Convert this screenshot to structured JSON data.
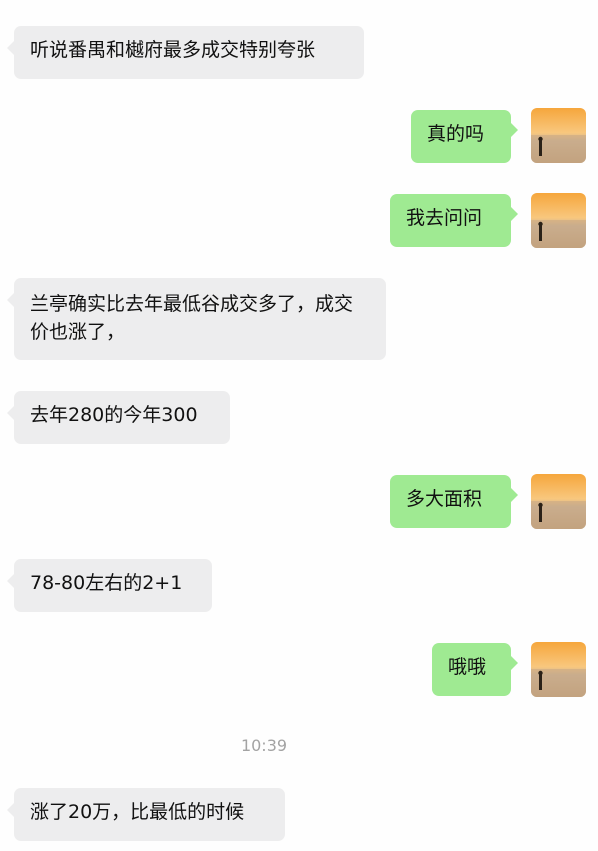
{
  "messages": [
    {
      "side": "left",
      "text": "听说番禺和樾府最多成交特别夸张"
    },
    {
      "side": "right",
      "text": "真的吗"
    },
    {
      "side": "right",
      "text": "我去问问"
    },
    {
      "side": "left",
      "text": "兰亭确实比去年最低谷成交多了，成交价也涨了，"
    },
    {
      "side": "left",
      "text": "去年280的今年300"
    },
    {
      "side": "right",
      "text": "多大面积"
    },
    {
      "side": "left",
      "text": "78-80左右的2+1"
    },
    {
      "side": "right",
      "text": "哦哦"
    },
    {
      "side": "left",
      "text": "涨了20万，比最低的时候"
    }
  ],
  "timestamp": "10:39",
  "colors": {
    "incoming_bubble": "#ededee",
    "outgoing_bubble": "#9fea92",
    "background": "#fefefe",
    "timestamp": "#a3a3a3"
  },
  "icons": {
    "avatar": "sunset-beach-avatar"
  }
}
